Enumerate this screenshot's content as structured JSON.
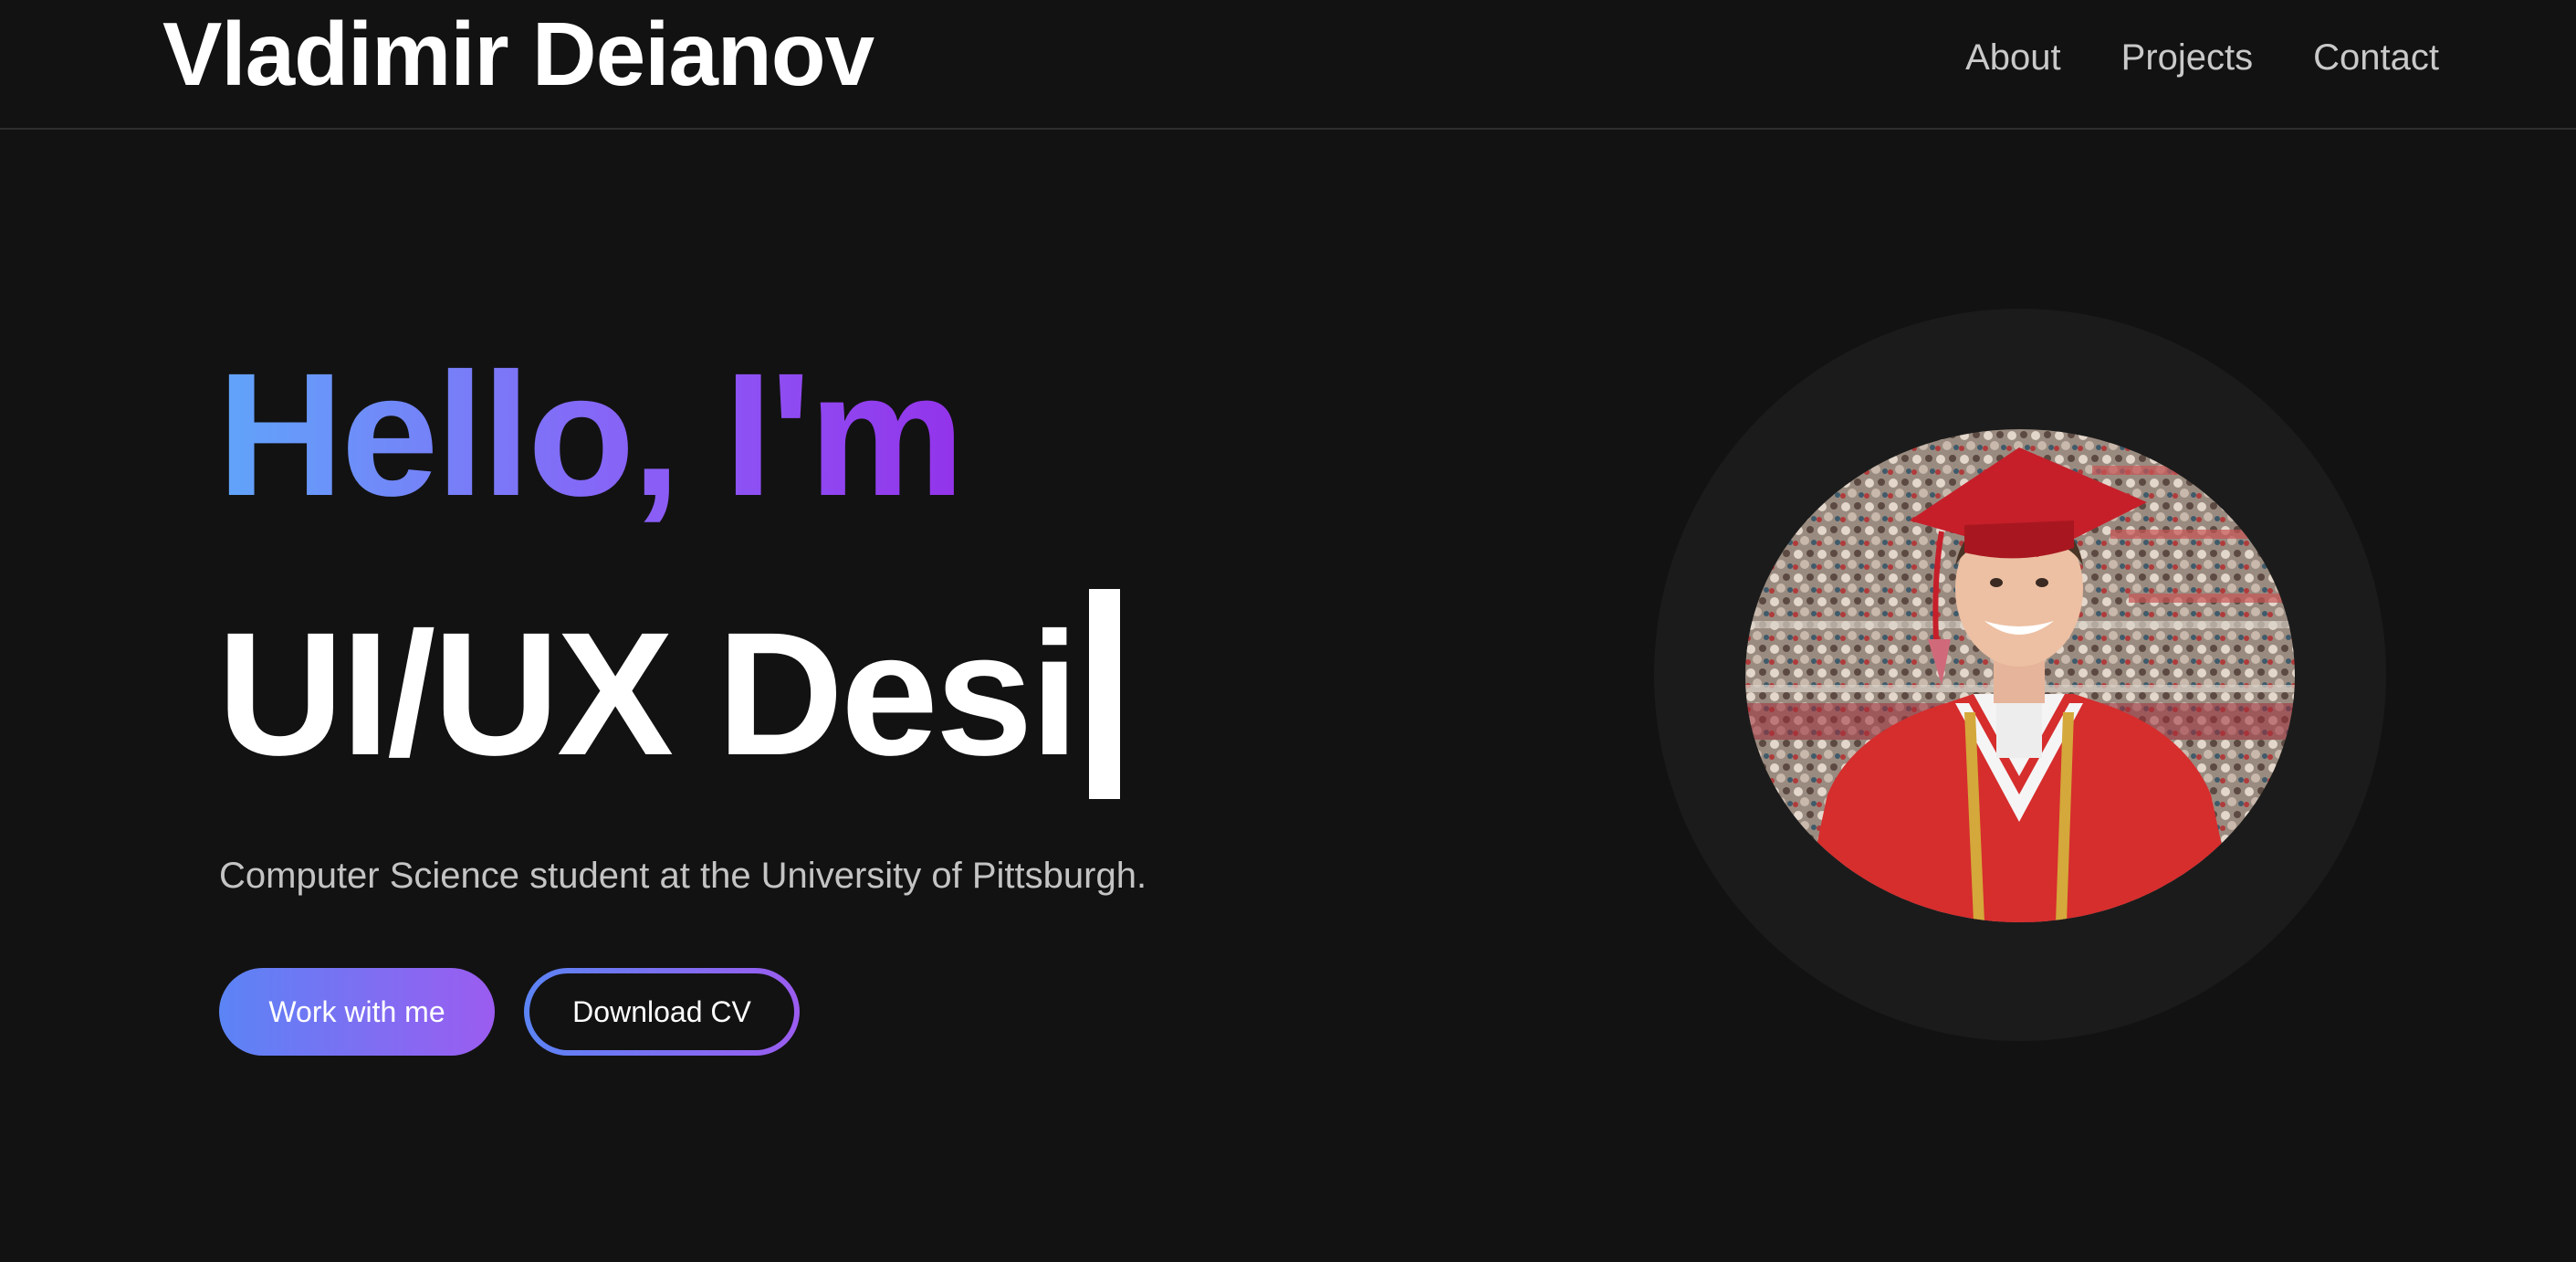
{
  "header": {
    "brand": "Vladimir Deianov",
    "nav": [
      {
        "label": "About"
      },
      {
        "label": "Projects"
      },
      {
        "label": "Contact"
      }
    ]
  },
  "hero": {
    "greeting": "Hello, I'm",
    "typed_role": "UI/UX Desi",
    "subtitle": "Computer Science student at the University of Pittsburgh.",
    "primary_button": "Work with me",
    "secondary_button": "Download CV"
  },
  "colors": {
    "background": "#121212",
    "gradient_start": "#60a5fa",
    "gradient_end": "#9333ea",
    "gown": "#d62d2d"
  },
  "portrait": {
    "icon": "graduation-portrait"
  }
}
